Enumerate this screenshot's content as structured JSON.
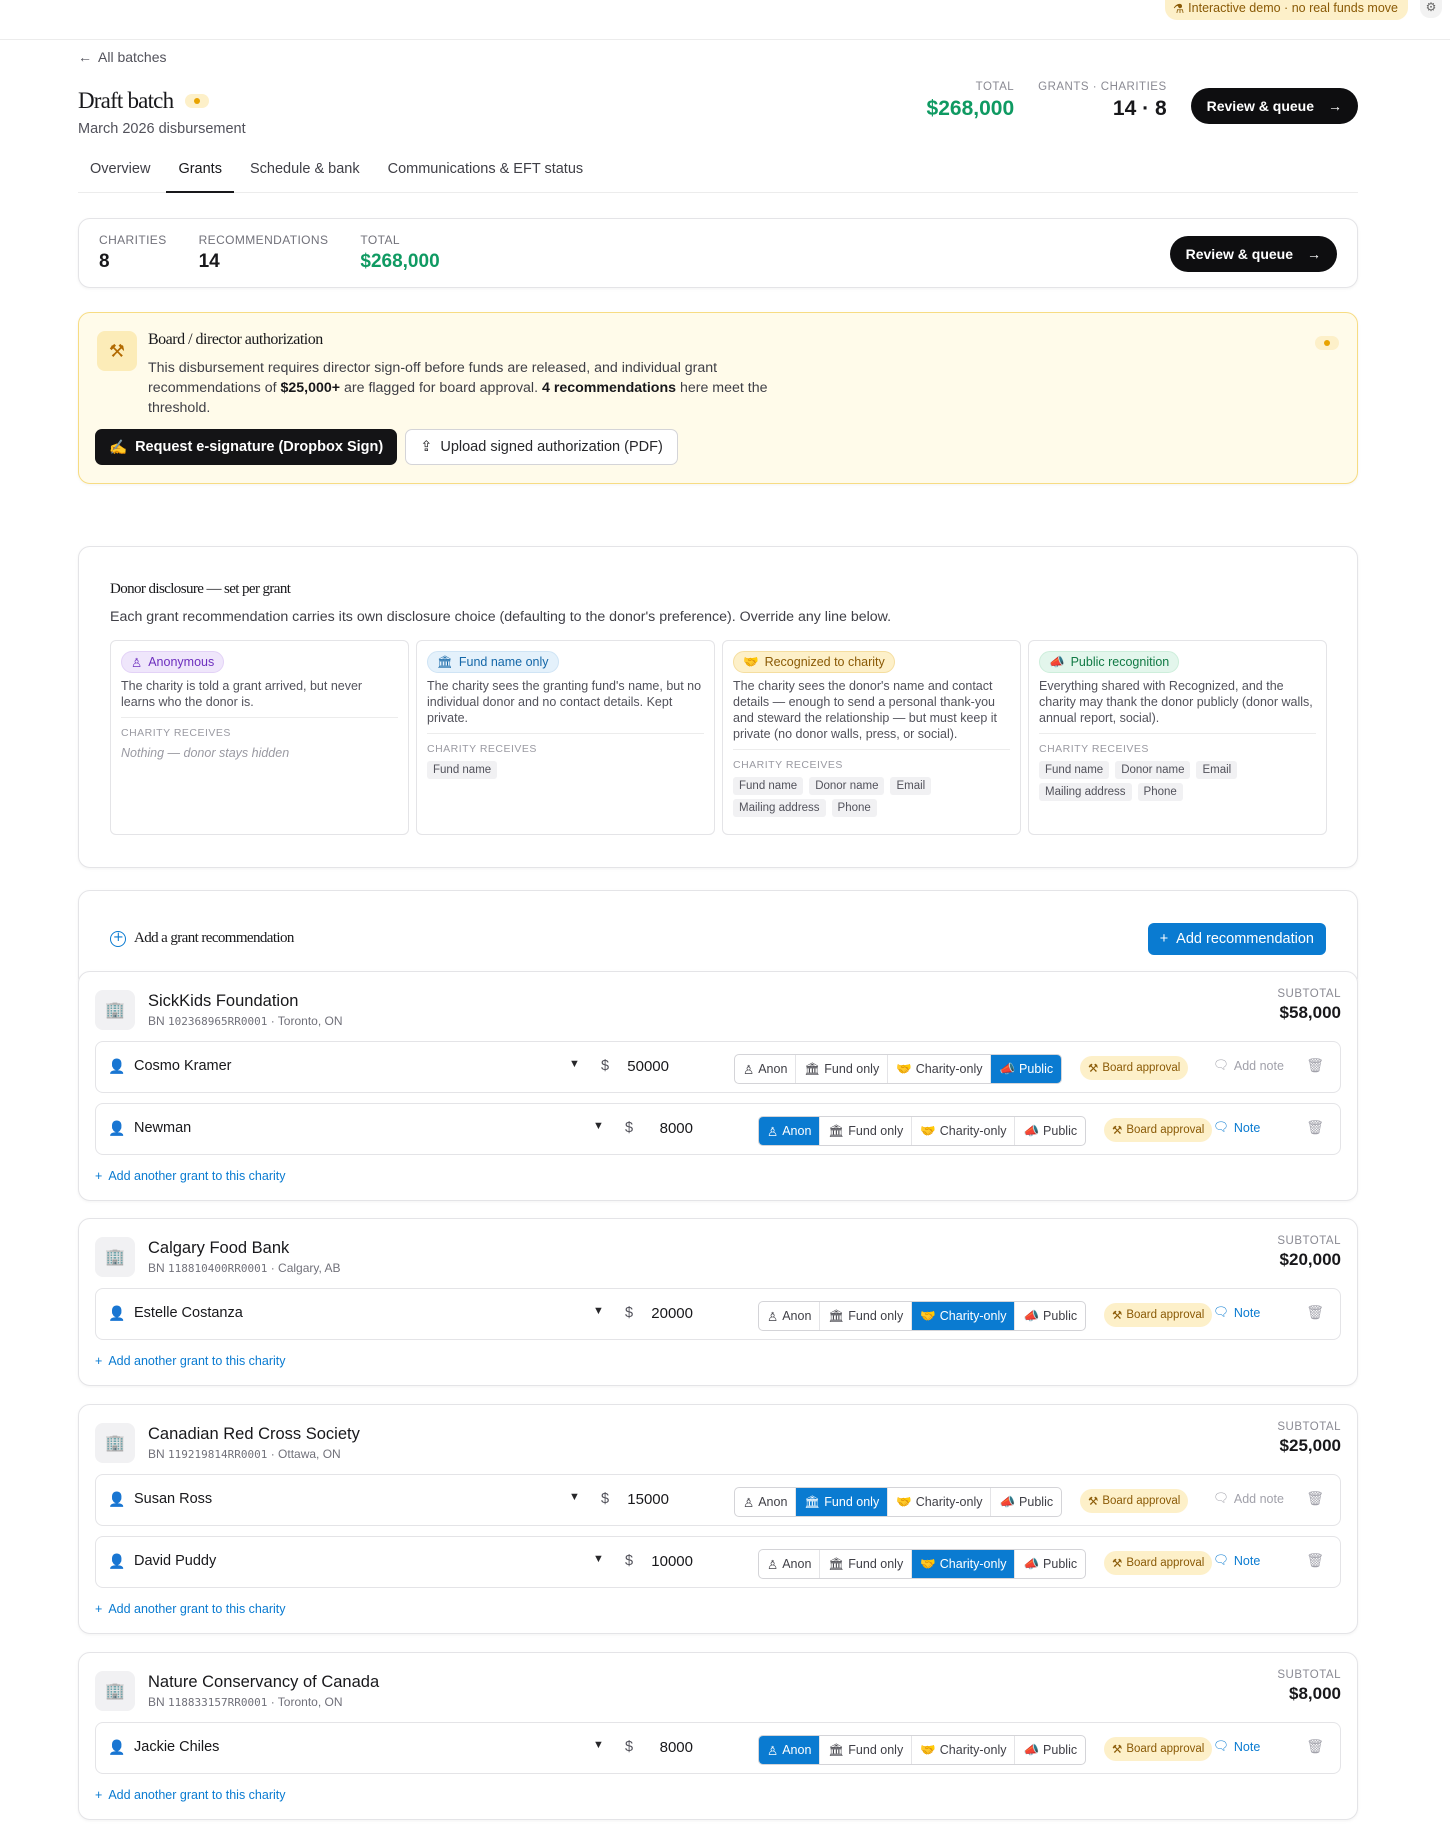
{
  "topbar": {
    "demo_label": "Interactive demo · no real funds move"
  },
  "header": {
    "back_label": "All batches",
    "title": "Draft batch",
    "subtitle": "March 2026 disbursement",
    "total_label": "TOTAL",
    "total_value": "$268,000",
    "grants_label": "GRANTS · CHARITIES",
    "grants_value": "14 · 8",
    "review_label": "Review & queue"
  },
  "tabs": [
    {
      "label": "Overview"
    },
    {
      "label": "Grants",
      "active": true
    },
    {
      "label": "Schedule & bank"
    },
    {
      "label": "Communications & EFT status"
    }
  ],
  "summary": {
    "charities_label": "CHARITIES",
    "charities_value": "8",
    "recs_label": "RECOMMENDATIONS",
    "recs_value": "14",
    "total_label": "TOTAL",
    "total_value": "$268,000",
    "review_label": "Review & queue"
  },
  "auth": {
    "title": "Board / director authorization",
    "text_1": "This disbursement requires director sign-off before funds are released, and individual grant recommendations of ",
    "threshold": "$25,000+",
    "text_2": " are flagged for board approval. ",
    "count": "4 recommendations",
    "text_3": " here meet the threshold.",
    "esign_label": "Request e-signature (Dropbox Sign)",
    "upload_label": "Upload signed authorization (PDF)"
  },
  "disclosure": {
    "title": "Donor disclosure — set per grant",
    "subtitle": "Each grant recommendation carries its own disclosure choice (defaulting to the donor's preference). Override any line below.",
    "receives_label": "CHARITY RECEIVES",
    "cards": [
      {
        "label": "Anonymous",
        "desc": "The charity is told a grant arrived, but never learns who the donor is.",
        "none": "Nothing — donor stays hidden",
        "chips": []
      },
      {
        "label": "Fund name only",
        "desc": "The charity sees the granting fund's name, but no individual donor and no contact details. Kept private.",
        "chips": [
          "Fund name"
        ]
      },
      {
        "label": "Recognized to charity",
        "desc": "The charity sees the donor's name and contact details — enough to send a personal thank-you and steward the relationship — but must keep it private (no donor walls, press, or social).",
        "chips": [
          "Fund name",
          "Donor name",
          "Email",
          "Mailing address",
          "Phone"
        ]
      },
      {
        "label": "Public recognition",
        "desc": "Everything shared with Recognized, and the charity may thank the donor publicly (donor walls, annual report, social).",
        "chips": [
          "Fund name",
          "Donor name",
          "Email",
          "Mailing address",
          "Phone"
        ]
      }
    ]
  },
  "add_rec": {
    "title": "Add a grant recommendation",
    "button": "Add recommendation"
  },
  "labels": {
    "subtotal": "SUBTOTAL",
    "add_another": "Add another grant to this charity",
    "board": "Board approval",
    "add_note": "Add note",
    "note": "Note",
    "dollar": "$",
    "opts": [
      "Anon",
      "Fund only",
      "Charity-only",
      "Public"
    ]
  },
  "charities": [
    {
      "name": "SickKids Foundation",
      "bn": "102368965RR0001",
      "loc": "· Toronto, ON",
      "subtotal": "$58,000",
      "grants": [
        {
          "donor": "Cosmo Kramer",
          "amount": "50000",
          "selected": 3,
          "note": "add"
        },
        {
          "donor": "Newman",
          "amount": "8000",
          "selected": 0,
          "note": "note"
        }
      ]
    },
    {
      "name": "Calgary Food Bank",
      "bn": "118810400RR0001",
      "loc": "· Calgary, AB",
      "subtotal": "$20,000",
      "grants": [
        {
          "donor": "Estelle Costanza",
          "amount": "20000",
          "selected": 2,
          "note": "note"
        }
      ]
    },
    {
      "name": "Canadian Red Cross Society",
      "bn": "119219814RR0001",
      "loc": "· Ottawa, ON",
      "subtotal": "$25,000",
      "grants": [
        {
          "donor": "Susan Ross",
          "amount": "15000",
          "selected": 1,
          "note": "add"
        },
        {
          "donor": "David Puddy",
          "amount": "10000",
          "selected": 2,
          "note": "note"
        }
      ]
    },
    {
      "name": "Nature Conservancy of Canada",
      "bn": "118833157RR0001",
      "loc": "· Toronto, ON",
      "subtotal": "$8,000",
      "grants": [
        {
          "donor": "Jackie Chiles",
          "amount": "8000",
          "selected": 0,
          "note": "note"
        }
      ]
    }
  ],
  "colors": {
    "accent": "#0a7bd1",
    "money": "#0f9a62",
    "warn_bg": "#fdf0c9",
    "warn_text": "#8a5a06"
  }
}
